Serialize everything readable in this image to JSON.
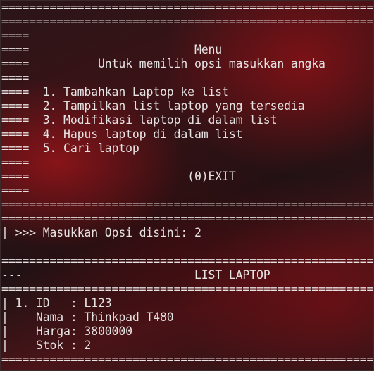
{
  "terminal": {
    "lines": [
      "==============================================================",
      "==============================================================",
      "====                                                      ====",
      "====                        Menu                          ====",
      "====          Untuk memilih opsi masukkan angka           ====",
      "====                                                      ====",
      "====  1. Tambahkan Laptop ke list                         ====",
      "====  2. Tampilkan list laptop yang tersedia              ====",
      "====  3. Modifikasi laptop di dalam list                  ====",
      "====  4. Hapus laptop di dalam list                       ====",
      "====  5. Cari laptop                                      ====",
      "====                                                      ====",
      "====                       (0)EXIT                        ====",
      "====                                                      ====",
      "==============================================================",
      "==============================================================",
      "| >>> Masukkan Opsi disini: 2",
      "",
      "==============================================================",
      "---                         LIST LAPTOP                    ---",
      "==============================================================",
      "| 1. ID   : L123",
      "|    Nama : Thinkpad T480",
      "|    Harga: 3800000",
      "|    Stok : 2",
      "=============================================================="
    ]
  },
  "menu": {
    "title": "Menu",
    "subtitle": "Untuk memilih opsi masukkan angka",
    "options": [
      "1. Tambahkan Laptop ke list",
      "2. Tampilkan list laptop yang tersedia",
      "3. Modifikasi laptop di dalam list",
      "4. Hapus laptop di dalam list",
      "5. Cari laptop"
    ],
    "exit_label": "(0)EXIT"
  },
  "prompt": {
    "label": "Masukkan Opsi disini:",
    "value": "2"
  },
  "laptop_list": {
    "header": "LIST LAPTOP",
    "items": [
      {
        "number": "1.",
        "id": "L123",
        "nama": "Thinkpad T480",
        "harga": "3800000",
        "stok": "2"
      }
    ]
  },
  "colors": {
    "text": "#e6e2e2",
    "background_dark": "#1e1214",
    "background_red": "#961419"
  }
}
